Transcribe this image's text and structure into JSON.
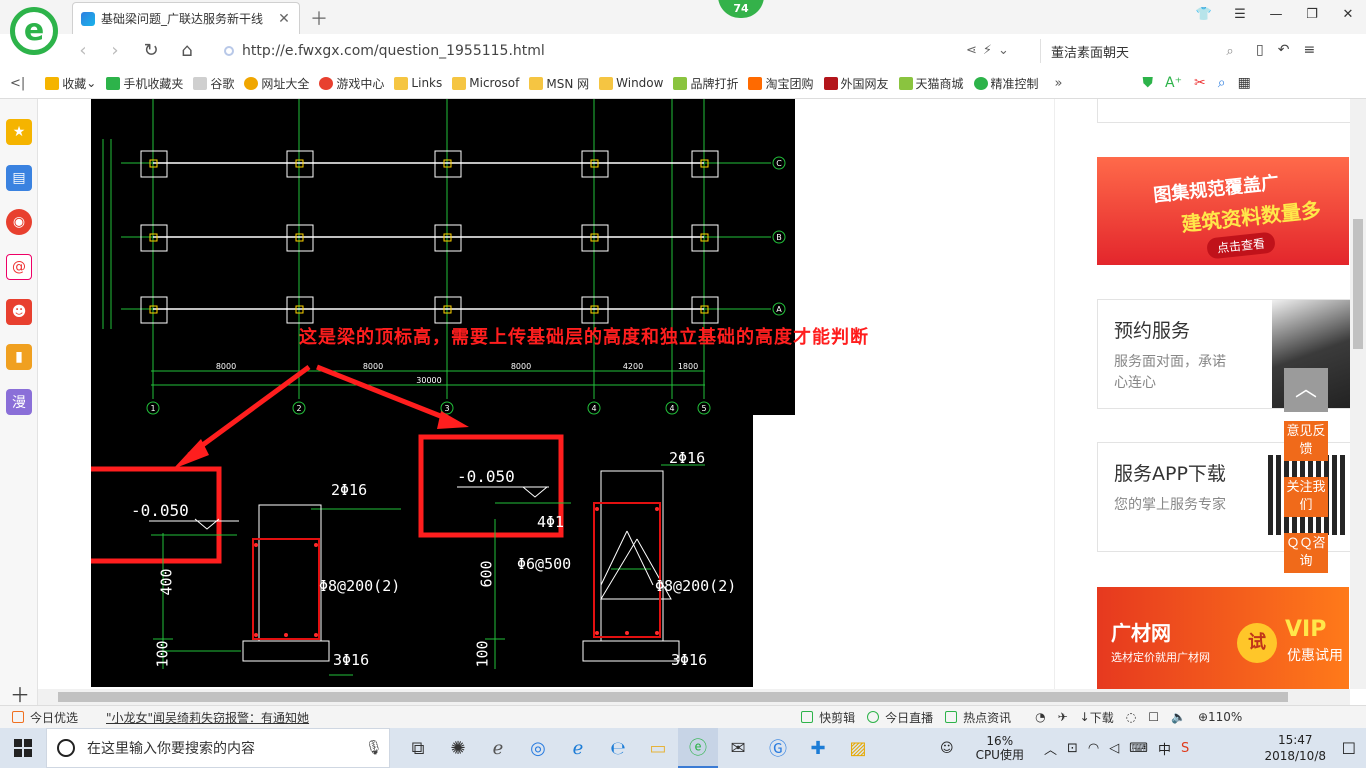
{
  "browser": {
    "tab_title": "基础梁问题_广联达服务新干线",
    "badge": "74",
    "url": "http://e.fwxgx.com/question_1955115.html",
    "search_text": "董洁素面朝天"
  },
  "bookmarks": [
    {
      "label": "收藏",
      "color": "#f5b400"
    },
    {
      "label": "手机收藏夹",
      "color": "#2db34a"
    },
    {
      "label": "谷歌",
      "color": "#cfcfcf"
    },
    {
      "label": "网址大全",
      "color": "#f0a600"
    },
    {
      "label": "游戏中心",
      "color": "#e8402f"
    },
    {
      "label": "Links",
      "color": "#f5c542"
    },
    {
      "label": "Microsof",
      "color": "#f5c542"
    },
    {
      "label": "MSN 网",
      "color": "#f5c542"
    },
    {
      "label": "Window",
      "color": "#f5c542"
    },
    {
      "label": "品牌打折",
      "color": "#8ac43f"
    },
    {
      "label": "淘宝团购",
      "color": "#ff6a00"
    },
    {
      "label": "外国网友",
      "color": "#b3151b"
    },
    {
      "label": "天猫商城",
      "color": "#8ac43f"
    },
    {
      "label": "精准控制",
      "color": "#2db34a"
    }
  ],
  "drawing": {
    "annotation": "这是梁的顶标高，需要上传基础层的高度和独立基础的高度才能判断",
    "left_section": {
      "level": "-0.050",
      "top_bar": "2Φ16",
      "stirrup": "Φ8@200(2)",
      "bottom_bar": "3Φ16",
      "height": "400",
      "base": "100"
    },
    "right_section": {
      "level": "-0.050",
      "top_bar": "2Φ16",
      "side_bar": "4Φ1",
      "tie": "Φ6@500",
      "stirrup": "Φ8@200(2)",
      "bottom_bar": "3Φ16",
      "height": "600",
      "base": "100"
    },
    "axis_letters": [
      "C",
      "B",
      "A"
    ],
    "axis_numbers": [
      "1",
      "2",
      "3",
      "4",
      "4",
      "5"
    ],
    "spans": [
      "8000",
      "8000",
      "8000",
      "4200",
      "1800"
    ],
    "total": "30000"
  },
  "right_sidebar": {
    "banner_top": {
      "line1": "图集规范覆盖广",
      "line2": "建筑资料数量多",
      "button": "点击查看"
    },
    "card1": {
      "title": "预约服务",
      "desc": "服务面对面，承诺心连心"
    },
    "card2": {
      "title": "服务APP下载",
      "desc": "您的掌上服务专家"
    },
    "banner_bottom": {
      "brand": "广材网",
      "sub": "选材定价就用广材网",
      "try": "试",
      "vip": "VIP",
      "vip_sub": "优惠试用"
    },
    "float": {
      "feedback": "意见反馈",
      "follow": "关注我们",
      "qq": "ＱＱ咨询"
    }
  },
  "statusbar": {
    "today": "今日优选",
    "news": "\"小龙女\"闻吴绮莉失窃报警：有通知她",
    "items": [
      "快剪辑",
      "今日直播",
      "热点资讯",
      "下载"
    ],
    "zoom": "110%"
  },
  "taskbar": {
    "search_placeholder": "在这里输入你要搜索的内容",
    "cpu_value": "16%",
    "cpu_label": "CPU使用",
    "ime": "中",
    "time": "15:47",
    "date": "2018/10/8"
  }
}
